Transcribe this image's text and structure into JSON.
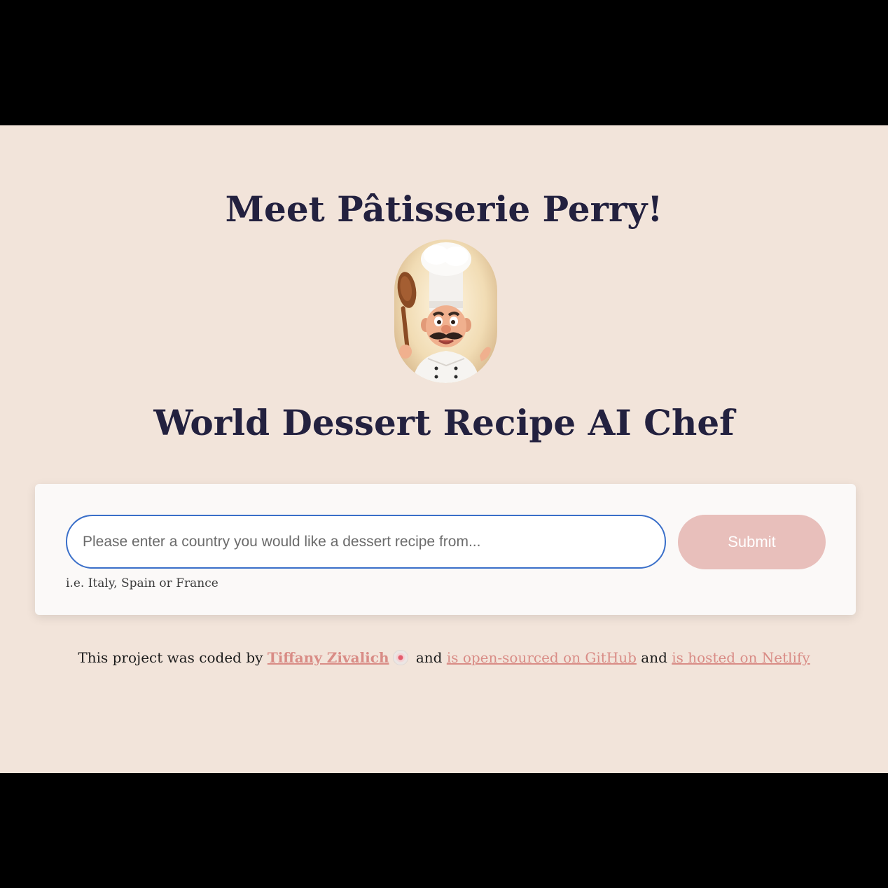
{
  "header": {
    "title": "Meet Pâtisserie Perry!",
    "subtitle": "World Dessert Recipe AI Chef"
  },
  "chef_image": {
    "icon": "chef-avatar"
  },
  "form": {
    "placeholder": "Please enter a country you would like a dessert recipe from...",
    "value": "",
    "submit_label": "Submit",
    "hint": "i.e. Italy, Spain or France"
  },
  "footer": {
    "prefix": "This project was coded by",
    "author_link": "Tiffany Zivalich",
    "author_icon": "cookie-icon",
    "and_1": "and",
    "github_link": "is open-sourced on GitHub",
    "and_2": "and",
    "netlify_link": "is hosted on Netlify"
  },
  "colors": {
    "background": "#f2e4da",
    "heading": "#23213f",
    "accent_link": "#d98c86",
    "button": "#e8bfbb",
    "input_border": "#3a6fc9"
  }
}
